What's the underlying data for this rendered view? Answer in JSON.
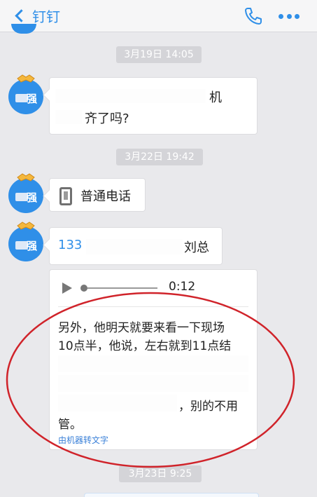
{
  "navbar": {
    "back_label": "钉钉",
    "title": ""
  },
  "messages": {
    "ts1": "3月19日 14:05",
    "msg1_line1_tail": "机",
    "msg1_line2": "齐了吗?",
    "ts2": "3月22日 19:42",
    "call_label": "普通电话",
    "phone_prefix": "133",
    "phone_suffix": "刘总",
    "voice_duration": "0:12",
    "transcript": {
      "line1": "另外，他明天就要来看一下现场",
      "line2": "10点半，他说，左右就到11点结",
      "line5": "，别的不用",
      "line6": "管。"
    },
    "machine_label": "由机器转文字",
    "ts3": "3月23日 9:25"
  },
  "avatar_text": "强",
  "colors": {
    "accent": "#2f8fe8",
    "annotation": "#d0232a"
  }
}
